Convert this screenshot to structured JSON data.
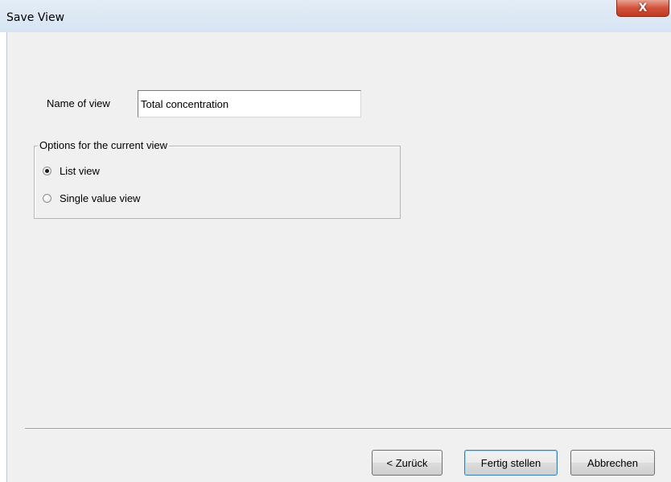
{
  "window": {
    "title": "Save View",
    "close_glyph": "X"
  },
  "form": {
    "name_label": "Name of view",
    "name_value": "Total concentration"
  },
  "options": {
    "group_title": "Options for the current view",
    "items": [
      {
        "label": "List view",
        "checked": true
      },
      {
        "label": "Single value view",
        "checked": false
      }
    ]
  },
  "buttons": {
    "back": "< Zurück",
    "finish": "Fertig stellen",
    "cancel": "Abbrechen"
  }
}
